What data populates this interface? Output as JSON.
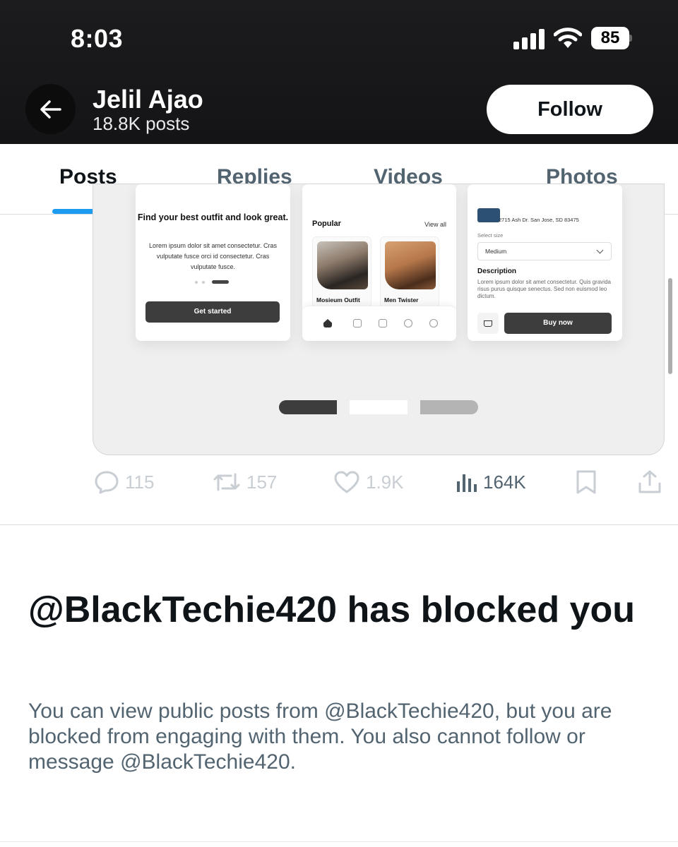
{
  "status_bar": {
    "time": "8:03",
    "battery": "85",
    "icons": [
      "signal-icon",
      "wifi-icon",
      "battery-icon"
    ]
  },
  "header": {
    "name": "Jelil Ajao",
    "posts_count": "18.8K posts",
    "follow_label": "Follow",
    "back_icon": "arrow-left-icon"
  },
  "tabs": [
    {
      "label": "Posts",
      "active": true
    },
    {
      "label": "Replies",
      "active": false
    },
    {
      "label": "Videos",
      "active": false
    },
    {
      "label": "Photos",
      "active": false
    }
  ],
  "media": {
    "screen1": {
      "heading": "Find your best outfit and look great.",
      "text": "Lorem ipsum dolor sit amet consectetur. Cras vulputate fusce orci id consectetur. Cras vulputate fusce.",
      "button": "Get started"
    },
    "screen2": {
      "section": "Popular",
      "view_all": "View all",
      "products": [
        "Mosieum Outfit",
        "Men Twister"
      ]
    },
    "screen3": {
      "address": "2715 Ash Dr. San Jose, SD 83475",
      "select_label": "Select size",
      "select_value": "Medium",
      "desc_title": "Description",
      "desc_text": "Lorem ipsum dolor sit amet consectetur. Quis gravida risus purus quisque senectus. Sed non euismod leo dictum.",
      "button": "Buy now"
    }
  },
  "actions": {
    "replies": "115",
    "reposts": "157",
    "likes": "1.9K",
    "views": "164K"
  },
  "block_notice": {
    "title": "@BlackTechie420 has blocked you",
    "body": "You can view public posts from @BlackTechie420, but you are blocked from engaging with them. You also cannot follow or message @BlackTechie420."
  },
  "colors": {
    "accent": "#1d9bf0",
    "header_bg": "#1c1c1e",
    "muted_text": "#536471"
  }
}
